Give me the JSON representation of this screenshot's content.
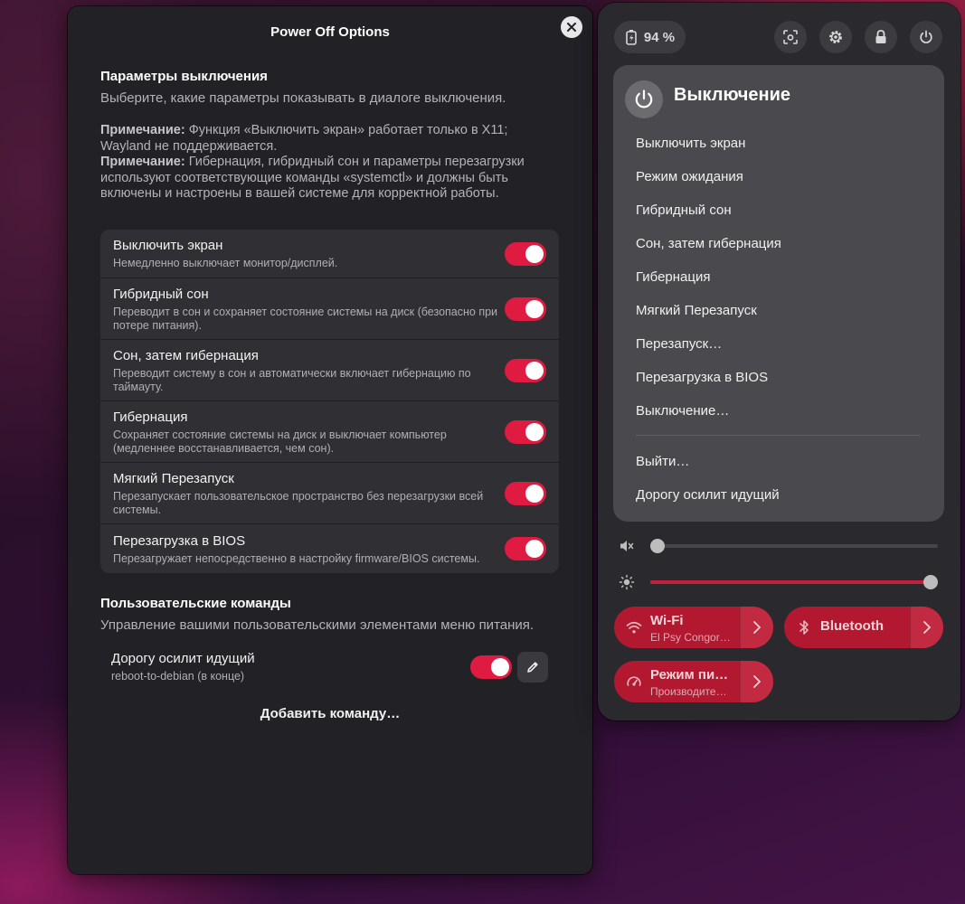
{
  "dialog": {
    "title": "Power Off Options",
    "section1_title": "Параметры выключения",
    "section1_desc": "Выберите, какие параметры показывать в диалоге выключения.",
    "note1_label": "Примечание:",
    "note1_text": " Функция «Выключить экран» работает только в X11; Wayland не поддерживается.",
    "note2_label": "Примечание:",
    "note2_text": " Гибернация, гибридный сон и параметры перезагрузки используют соответствующие команды «systemctl» и должны быть включены и настроены в вашей системе для корректной работы.",
    "options": [
      {
        "title": "Выключить экран",
        "subtitle": "Немедленно выключает монитор/дисплей.",
        "enabled": true
      },
      {
        "title": "Гибридный сон",
        "subtitle": "Переводит в сон и сохраняет состояние системы на диск (безопасно при потере питания).",
        "enabled": true
      },
      {
        "title": "Сон, затем гибернация",
        "subtitle": "Переводит систему в сон и автоматически включает гибернацию по таймауту.",
        "enabled": true
      },
      {
        "title": "Гибернация",
        "subtitle": "Сохраняет состояние системы на диск и выключает компьютер (медленнее восстанавливается, чем сон).",
        "enabled": true
      },
      {
        "title": "Мягкий Перезапуск",
        "subtitle": "Перезапускает пользовательское пространство без перезагрузки всей системы.",
        "enabled": true
      },
      {
        "title": "Перезагрузка в BIOS",
        "subtitle": "Перезагружает непосредственно в настройку firmware/BIOS системы.",
        "enabled": true
      }
    ],
    "section2_title": "Пользовательские команды",
    "section2_desc": "Управление вашими пользовательскими элементами меню питания.",
    "custom_command": {
      "title": "Дорогу осилит идущий",
      "subtitle": "reboot-to-debian (в конце)",
      "enabled": true
    },
    "add_command_label": "Добавить команду…"
  },
  "panel": {
    "battery_label": "94 %",
    "top_icons": [
      "screenshot-icon",
      "settings-icon",
      "lock-icon",
      "power-icon"
    ],
    "menu_title": "Выключение",
    "menu_items": [
      "Выключить экран",
      "Режим ожидания",
      "Гибридный сон",
      "Сон, затем гибернация",
      "Гибернация",
      "Мягкий Перезапуск",
      "Перезапуск…",
      "Перезагрузка в BIOS",
      "Выключение…"
    ],
    "menu_items_after_sep": [
      "Выйти…",
      "Дорогу осилит идущий"
    ],
    "volume_level": 0.0,
    "brightness_level": 1.0,
    "tiles": [
      {
        "title": "Wi-Fi",
        "subtitle": "El Psy Congor…",
        "icon": "wifi-icon"
      },
      {
        "title": "Bluetooth",
        "subtitle": "",
        "icon": "bluetooth-icon"
      },
      {
        "title": "Режим пи…",
        "subtitle": "Производите…",
        "icon": "power-mode-icon"
      }
    ],
    "accent_color": "#e01b42"
  }
}
